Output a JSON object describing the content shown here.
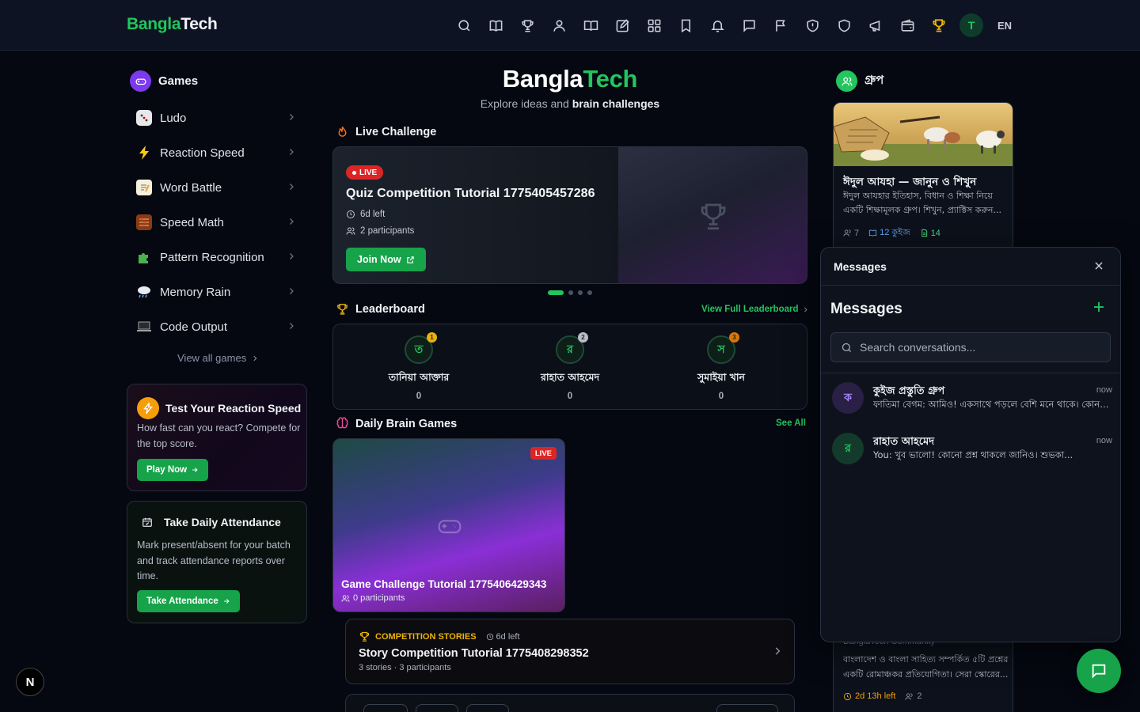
{
  "brand": {
    "part1": "Bangla",
    "part2": "Tech"
  },
  "nav": {
    "icons": [
      "search-icon",
      "book-icon",
      "trophy-icon",
      "users-icon",
      "open-book-icon",
      "edit-icon",
      "apps-grid-icon",
      "bookmark-icon",
      "bell-icon",
      "chat-icon",
      "flag-icon",
      "shield-alert-icon",
      "shield-icon",
      "megaphone-icon",
      "wallet-icon",
      "gold-trophy-icon"
    ],
    "avatar": "T",
    "lang": "EN"
  },
  "sidebar": {
    "title": "Games",
    "items": [
      {
        "label": "Ludo",
        "icon": "dice-icon"
      },
      {
        "label": "Reaction Speed",
        "icon": "lightning-icon"
      },
      {
        "label": "Word Battle",
        "icon": "memo-icon"
      },
      {
        "label": "Speed Math",
        "icon": "abacus-icon"
      },
      {
        "label": "Pattern Recognition",
        "icon": "puzzle-icon"
      },
      {
        "label": "Memory Rain",
        "icon": "rain-cloud-icon"
      },
      {
        "label": "Code Output",
        "icon": "laptop-icon"
      }
    ],
    "view_all": "View all games",
    "reaction_card": {
      "title": "Test Your Reaction Speed",
      "desc": "How fast can you react? Compete for the top score.",
      "button": "Play Now"
    },
    "attendance_card": {
      "title": "Take Daily Attendance",
      "desc": "Mark present/absent for your batch and track attendance reports over time.",
      "button": "Take Attendance"
    }
  },
  "hero": {
    "title_part1": "Bangla",
    "title_part2": "Tech",
    "subtitle_plain": "Explore ideas and ",
    "subtitle_bold": "brain challenges"
  },
  "live_challenge": {
    "heading": "Live Challenge",
    "badge": "LIVE",
    "title": "Quiz Competition Tutorial 1775405457286",
    "time_left": "6d left",
    "participants": "2 participants",
    "button": "Join Now",
    "slide_count": 4,
    "active_slide": 1
  },
  "leaderboard": {
    "heading": "Leaderboard",
    "link": "View Full Leaderboard",
    "entries": [
      {
        "initial": "ত",
        "name": "তানিয়া আক্তার",
        "score": "0",
        "rank": "1",
        "medal_color": "#eab308"
      },
      {
        "initial": "র",
        "name": "রাহাত আহমেদ",
        "score": "0",
        "rank": "2",
        "medal_color": "#b8bec9"
      },
      {
        "initial": "স",
        "name": "সুমাইয়া খান",
        "score": "0",
        "rank": "3",
        "medal_color": "#d97706"
      }
    ]
  },
  "brain_games": {
    "heading": "Daily Brain Games",
    "link": "See All",
    "card": {
      "badge": "LIVE",
      "title": "Game Challenge Tutorial 1775406429343",
      "participants": "0 participants"
    }
  },
  "story": {
    "tag": "COMPETITION STORIES",
    "time_left": "6d left",
    "title": "Story Competition Tutorial 1775408298352",
    "meta": "3 stories · 3 participants"
  },
  "groups": {
    "heading": "গ্রুপ",
    "card": {
      "title": "ঈদুল আযহা — জানুন ও শিখুন",
      "desc": "ঈদুল আযহার ইতিহাস, বিধান ও শিক্ষা নিয়ে একটি শিক্ষামূলক গ্রুপ। শিখুন, প্র্যাক্টিস করুন...",
      "members": "7",
      "quizzes": "12 কুইজ",
      "docs": "14"
    }
  },
  "community": {
    "name": "BanglaTech Community",
    "desc": "বাংলাদেশ ও বাংলা সাহিত্য সম্পর্কিত ৫টি প্রশ্নের একটি রোমাঞ্চকর প্রতিযোগিতা। সেরা স্কোরের...",
    "time_left": "2d 13h left",
    "participants": "2"
  },
  "messages": {
    "panel_title": "Messages",
    "heading": "Messages",
    "search_placeholder": "Search conversations...",
    "conversations": [
      {
        "initial": "ক",
        "name": "কুইজ প্রস্তুতি গ্রুপ",
        "time": "now",
        "preview": "ফাতিমা বেগম: আমিও! একসাথে পড়লে বেশি মনে থাকে। কোন ...",
        "bg": "#2a1f44",
        "fg": "#a78bfa"
      },
      {
        "initial": "র",
        "name": "রাহাত আহমেদ",
        "time": "now",
        "preview": "You: খুব ভালো! কোনো প্রশ্ন থাকলে জানিও। শুভকা...",
        "bg": "#143a2b",
        "fg": "#22c55e"
      }
    ]
  },
  "colors": {
    "accent": "#22c55e",
    "live": "#dc2626",
    "gold": "#eab308"
  },
  "next_badge": "N"
}
